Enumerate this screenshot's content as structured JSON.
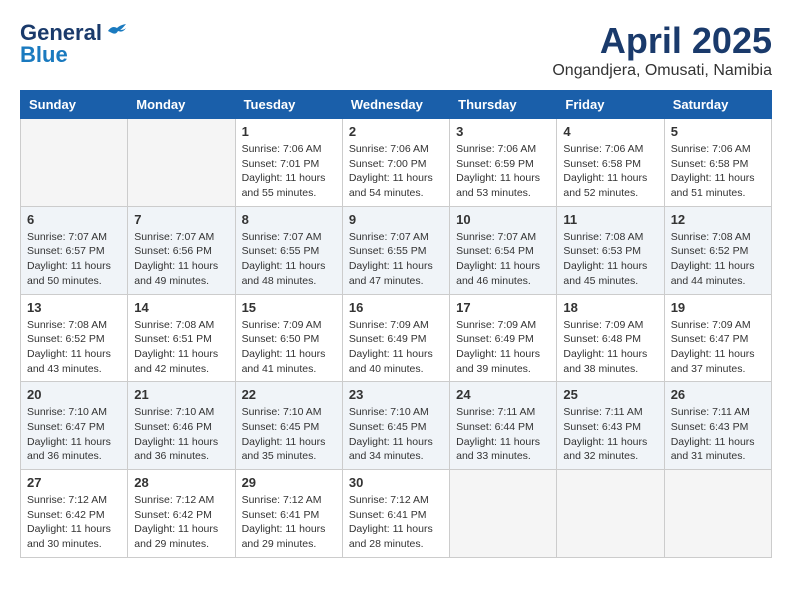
{
  "header": {
    "logo_general": "General",
    "logo_blue": "Blue",
    "month": "April 2025",
    "location": "Ongandjera, Omusati, Namibia"
  },
  "weekdays": [
    "Sunday",
    "Monday",
    "Tuesday",
    "Wednesday",
    "Thursday",
    "Friday",
    "Saturday"
  ],
  "weeks": [
    [
      {
        "day": "",
        "info": ""
      },
      {
        "day": "",
        "info": ""
      },
      {
        "day": "1",
        "info": "Sunrise: 7:06 AM\nSunset: 7:01 PM\nDaylight: 11 hours and 55 minutes."
      },
      {
        "day": "2",
        "info": "Sunrise: 7:06 AM\nSunset: 7:00 PM\nDaylight: 11 hours and 54 minutes."
      },
      {
        "day": "3",
        "info": "Sunrise: 7:06 AM\nSunset: 6:59 PM\nDaylight: 11 hours and 53 minutes."
      },
      {
        "day": "4",
        "info": "Sunrise: 7:06 AM\nSunset: 6:58 PM\nDaylight: 11 hours and 52 minutes."
      },
      {
        "day": "5",
        "info": "Sunrise: 7:06 AM\nSunset: 6:58 PM\nDaylight: 11 hours and 51 minutes."
      }
    ],
    [
      {
        "day": "6",
        "info": "Sunrise: 7:07 AM\nSunset: 6:57 PM\nDaylight: 11 hours and 50 minutes."
      },
      {
        "day": "7",
        "info": "Sunrise: 7:07 AM\nSunset: 6:56 PM\nDaylight: 11 hours and 49 minutes."
      },
      {
        "day": "8",
        "info": "Sunrise: 7:07 AM\nSunset: 6:55 PM\nDaylight: 11 hours and 48 minutes."
      },
      {
        "day": "9",
        "info": "Sunrise: 7:07 AM\nSunset: 6:55 PM\nDaylight: 11 hours and 47 minutes."
      },
      {
        "day": "10",
        "info": "Sunrise: 7:07 AM\nSunset: 6:54 PM\nDaylight: 11 hours and 46 minutes."
      },
      {
        "day": "11",
        "info": "Sunrise: 7:08 AM\nSunset: 6:53 PM\nDaylight: 11 hours and 45 minutes."
      },
      {
        "day": "12",
        "info": "Sunrise: 7:08 AM\nSunset: 6:52 PM\nDaylight: 11 hours and 44 minutes."
      }
    ],
    [
      {
        "day": "13",
        "info": "Sunrise: 7:08 AM\nSunset: 6:52 PM\nDaylight: 11 hours and 43 minutes."
      },
      {
        "day": "14",
        "info": "Sunrise: 7:08 AM\nSunset: 6:51 PM\nDaylight: 11 hours and 42 minutes."
      },
      {
        "day": "15",
        "info": "Sunrise: 7:09 AM\nSunset: 6:50 PM\nDaylight: 11 hours and 41 minutes."
      },
      {
        "day": "16",
        "info": "Sunrise: 7:09 AM\nSunset: 6:49 PM\nDaylight: 11 hours and 40 minutes."
      },
      {
        "day": "17",
        "info": "Sunrise: 7:09 AM\nSunset: 6:49 PM\nDaylight: 11 hours and 39 minutes."
      },
      {
        "day": "18",
        "info": "Sunrise: 7:09 AM\nSunset: 6:48 PM\nDaylight: 11 hours and 38 minutes."
      },
      {
        "day": "19",
        "info": "Sunrise: 7:09 AM\nSunset: 6:47 PM\nDaylight: 11 hours and 37 minutes."
      }
    ],
    [
      {
        "day": "20",
        "info": "Sunrise: 7:10 AM\nSunset: 6:47 PM\nDaylight: 11 hours and 36 minutes."
      },
      {
        "day": "21",
        "info": "Sunrise: 7:10 AM\nSunset: 6:46 PM\nDaylight: 11 hours and 36 minutes."
      },
      {
        "day": "22",
        "info": "Sunrise: 7:10 AM\nSunset: 6:45 PM\nDaylight: 11 hours and 35 minutes."
      },
      {
        "day": "23",
        "info": "Sunrise: 7:10 AM\nSunset: 6:45 PM\nDaylight: 11 hours and 34 minutes."
      },
      {
        "day": "24",
        "info": "Sunrise: 7:11 AM\nSunset: 6:44 PM\nDaylight: 11 hours and 33 minutes."
      },
      {
        "day": "25",
        "info": "Sunrise: 7:11 AM\nSunset: 6:43 PM\nDaylight: 11 hours and 32 minutes."
      },
      {
        "day": "26",
        "info": "Sunrise: 7:11 AM\nSunset: 6:43 PM\nDaylight: 11 hours and 31 minutes."
      }
    ],
    [
      {
        "day": "27",
        "info": "Sunrise: 7:12 AM\nSunset: 6:42 PM\nDaylight: 11 hours and 30 minutes."
      },
      {
        "day": "28",
        "info": "Sunrise: 7:12 AM\nSunset: 6:42 PM\nDaylight: 11 hours and 29 minutes."
      },
      {
        "day": "29",
        "info": "Sunrise: 7:12 AM\nSunset: 6:41 PM\nDaylight: 11 hours and 29 minutes."
      },
      {
        "day": "30",
        "info": "Sunrise: 7:12 AM\nSunset: 6:41 PM\nDaylight: 11 hours and 28 minutes."
      },
      {
        "day": "",
        "info": ""
      },
      {
        "day": "",
        "info": ""
      },
      {
        "day": "",
        "info": ""
      }
    ]
  ]
}
